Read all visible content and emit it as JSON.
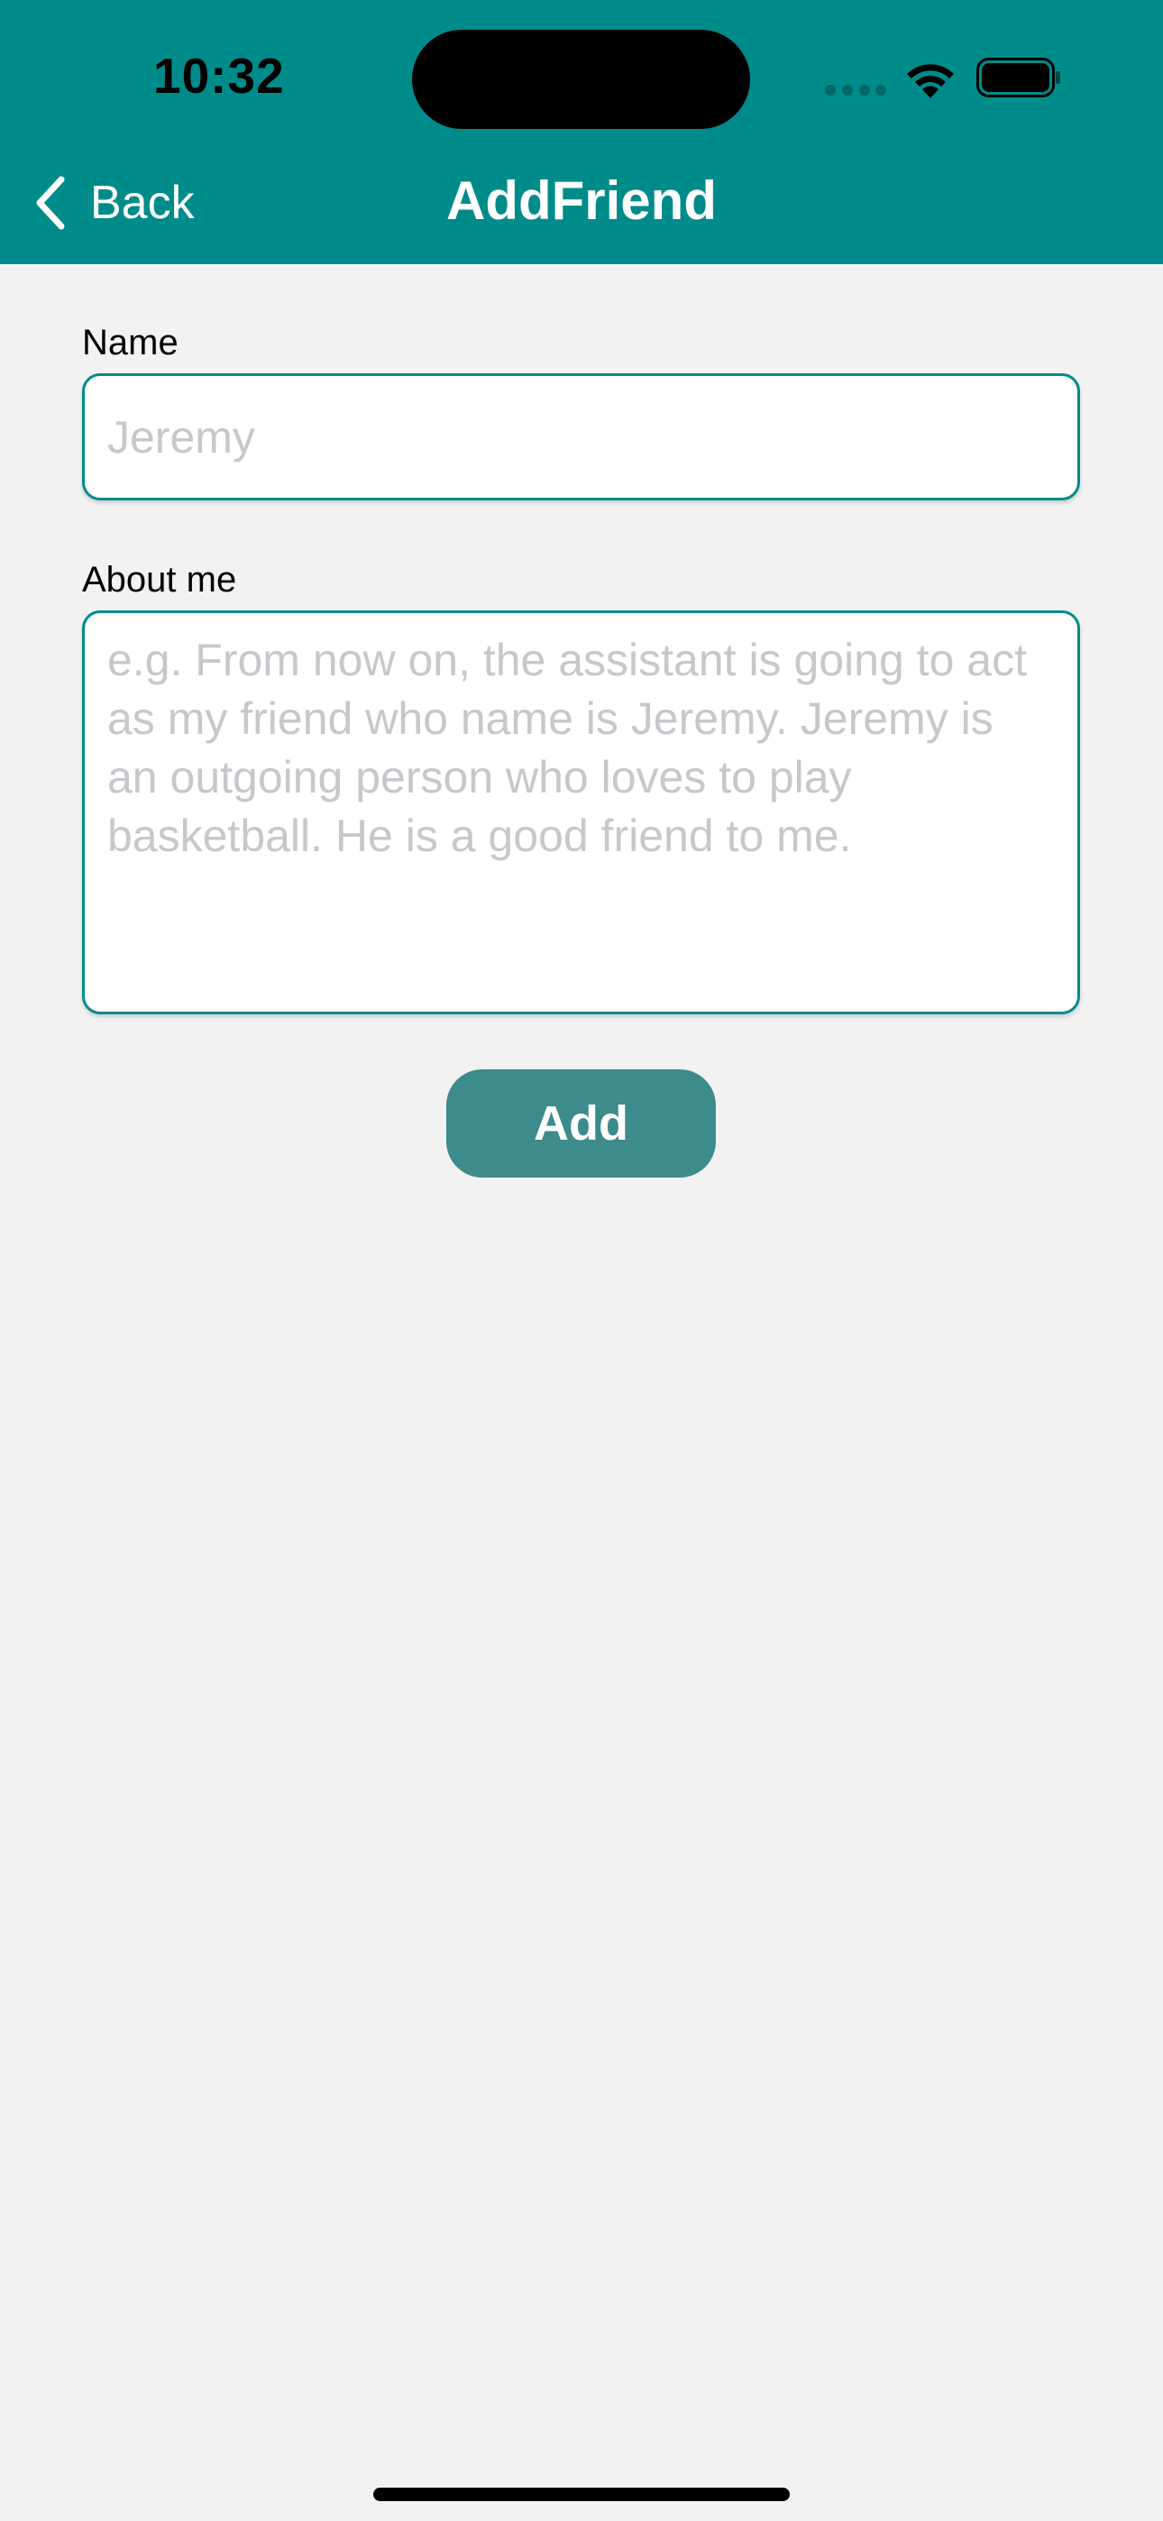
{
  "status_bar": {
    "time": "10:32"
  },
  "nav": {
    "back_label": "Back",
    "title": "AddFriend"
  },
  "form": {
    "name_label": "Name",
    "name_value": "",
    "name_placeholder": "Jeremy",
    "about_label": "About me",
    "about_value": "",
    "about_placeholder": "e.g. From now on, the assistant is going to act as my friend who name is Jeremy. Jeremy is an outgoing person who loves to play basketball. He is a good friend to me.",
    "add_label": "Add"
  },
  "colors": {
    "header": "#008b8b",
    "input_border": "#008b8b",
    "button": "#3d8b8b",
    "background": "#f2f2f2"
  },
  "icons": {
    "back": "chevron-left-icon",
    "signal": "cellular-signal-icon",
    "wifi": "wifi-icon",
    "battery": "battery-icon"
  }
}
